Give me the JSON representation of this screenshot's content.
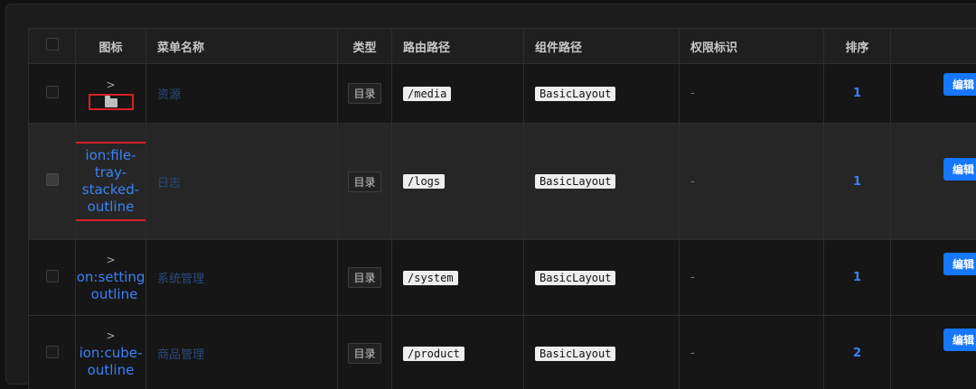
{
  "table": {
    "headers": {
      "icon": "图标",
      "menu_name": "菜单名称",
      "type": "类型",
      "route_path": "路由路径",
      "component_path": "组件路径",
      "permission": "权限标识",
      "order": "排序"
    },
    "rows": [
      {
        "expander": ">",
        "icon_text": "",
        "menu_name": "资源",
        "type": "目录",
        "route_path": "/media",
        "component_path": "BasicLayout",
        "permission": "-",
        "order": "1",
        "edit_label": "编辑"
      },
      {
        "expander": "",
        "icon_text": "ion:file-tray-stacked-outline",
        "menu_name": "日志",
        "type": "目录",
        "route_path": "/logs",
        "component_path": "BasicLayout",
        "permission": "-",
        "order": "1",
        "edit_label": "编辑"
      },
      {
        "expander": ">",
        "icon_text": "on:settings outline",
        "menu_name": "系统管理",
        "type": "目录",
        "route_path": "/system",
        "component_path": "BasicLayout",
        "permission": "-",
        "order": "1",
        "edit_label": "编辑"
      },
      {
        "expander": ">",
        "icon_text": "ion:cube-outline",
        "menu_name": "商品管理",
        "type": "目录",
        "route_path": "/product",
        "component_path": "BasicLayout",
        "permission": "-",
        "order": "2",
        "edit_label": "编辑"
      }
    ]
  },
  "icons": {
    "row0_icon": "folder-icon"
  },
  "colors": {
    "accent": "#1677ff",
    "link": "#3b82f6",
    "danger": "#e5484d",
    "highlight_box": "#d9202a"
  }
}
